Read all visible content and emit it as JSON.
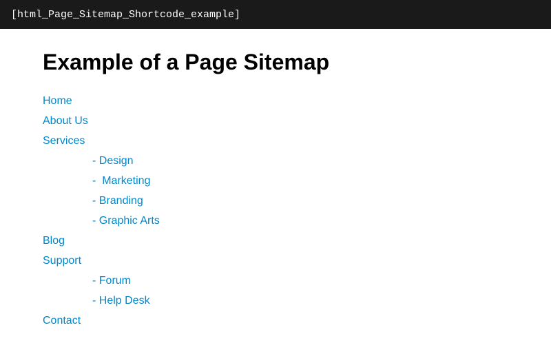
{
  "topbar": {
    "text": "[html_Page_Sitemap_Shortcode_example]"
  },
  "header": {
    "title": "Example of a Page Sitemap"
  },
  "sitemap": {
    "items": [
      {
        "label": "Home",
        "href": "#"
      },
      {
        "label": "About Us",
        "href": "#"
      },
      {
        "label": "Services",
        "href": "#",
        "children": [
          {
            "label": "- Design",
            "href": "#"
          },
          {
            "label": "-  Marketing",
            "href": "#"
          },
          {
            "label": "- Branding",
            "href": "#"
          },
          {
            "label": "- Graphic Arts",
            "href": "#"
          }
        ]
      },
      {
        "label": "Blog",
        "href": "#"
      },
      {
        "label": "Support",
        "href": "#",
        "children": [
          {
            "label": "- Forum",
            "href": "#"
          },
          {
            "label": "- Help Desk",
            "href": "#"
          }
        ]
      },
      {
        "label": "Contact",
        "href": "#"
      }
    ]
  }
}
